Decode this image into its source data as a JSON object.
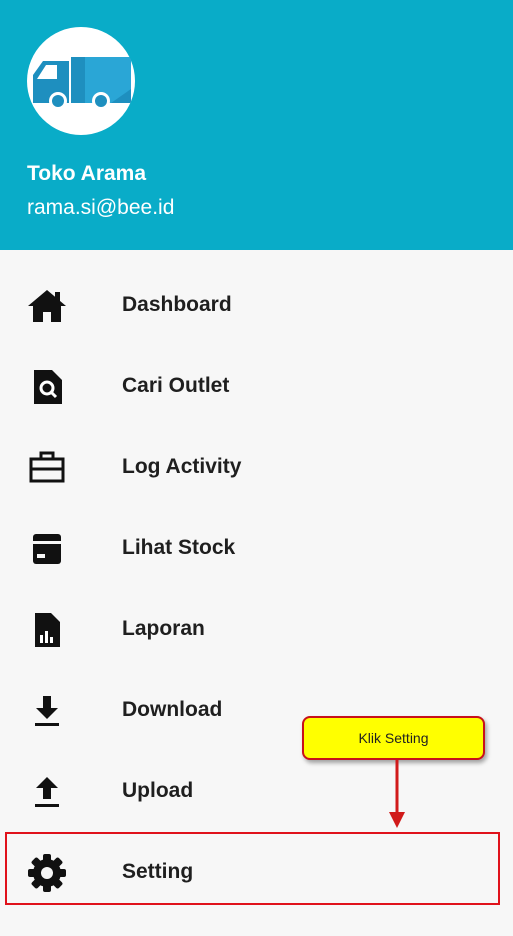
{
  "header": {
    "store_name": "Toko Arama",
    "email": "rama.si@bee.id",
    "background_color": "#09acc8",
    "avatar_icon": "truck-icon"
  },
  "menu": {
    "items": [
      {
        "label": "Dashboard",
        "icon": "home-icon"
      },
      {
        "label": "Cari Outlet",
        "icon": "search-file-icon"
      },
      {
        "label": "Log Activity",
        "icon": "briefcase-icon"
      },
      {
        "label": "Lihat Stock",
        "icon": "inventory-box-icon"
      },
      {
        "label": "Laporan",
        "icon": "report-chart-icon"
      },
      {
        "label": "Download",
        "icon": "download-icon"
      },
      {
        "label": "Upload",
        "icon": "upload-icon"
      },
      {
        "label": "Setting",
        "icon": "gear-icon"
      }
    ]
  },
  "annotation": {
    "callout_text": "Klik Setting",
    "callout_color": "#ffff00",
    "highlight_color": "#e0121b"
  }
}
